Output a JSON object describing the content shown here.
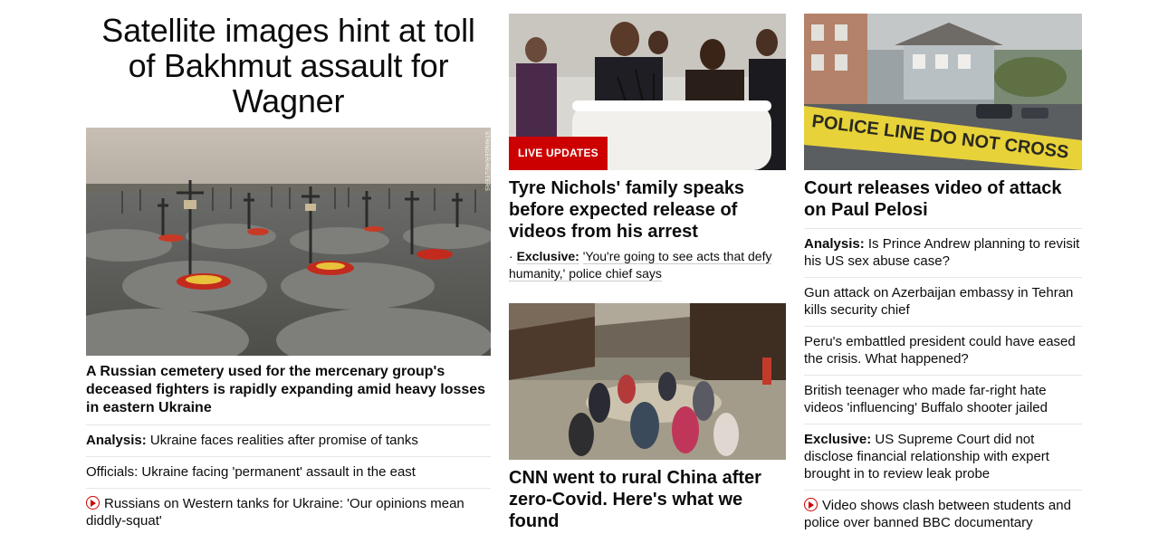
{
  "lead": {
    "headline": "Satellite images hint at toll of Bakhmut assault for Wagner",
    "photo_credit": "STRINGER/REUTERS",
    "subheadline": "A Russian cemetery used for the mercenary group's deceased fighters is rapidly expanding amid heavy losses in eastern Ukraine",
    "related": [
      {
        "prefix": "Analysis:",
        "text": "Ukraine faces realities after promise of tanks"
      },
      {
        "prefix": "",
        "text": "Officials: Ukraine facing 'permanent' assault in the east"
      },
      {
        "prefix": "",
        "text": "Russians on Western tanks for Ukraine: 'Our opinions mean diddly-squat'",
        "icon": "play-icon"
      }
    ]
  },
  "middle": {
    "story1": {
      "badge": "LIVE UPDATES",
      "headline": "Tyre Nichols' family speaks before expected release of videos from his arrest",
      "sub_prefix": "Exclusive:",
      "sub_text": "'You're going to see acts that defy humanity,' police chief says"
    },
    "story2": {
      "headline": "CNN went to rural China after zero-Covid. Here's what we found"
    }
  },
  "right": {
    "headline": "Court releases video of attack on Paul Pelosi",
    "tape_text": "POLICE LINE DO NOT CROSS",
    "items": [
      {
        "prefix": "Analysis:",
        "text": "Is Prince Andrew planning to revisit his US sex abuse case?"
      },
      {
        "prefix": "",
        "text": "Gun attack on Azerbaijan embassy in Tehran kills security chief"
      },
      {
        "prefix": "",
        "text": "Peru's embattled president could have eased the crisis. What happened?"
      },
      {
        "prefix": "",
        "text": "British teenager who made far-right hate videos 'influencing' Buffalo shooter jailed"
      },
      {
        "prefix": "Exclusive:",
        "text": "US Supreme Court did not disclose financial relationship with expert brought in to review leak probe"
      },
      {
        "prefix": "",
        "text": "Video shows clash between students and police over banned BBC documentary",
        "icon": "play-icon"
      }
    ]
  },
  "colors": {
    "brand_red": "#cc0000",
    "divider": "#e6e6e6",
    "text": "#0c0c0c"
  }
}
